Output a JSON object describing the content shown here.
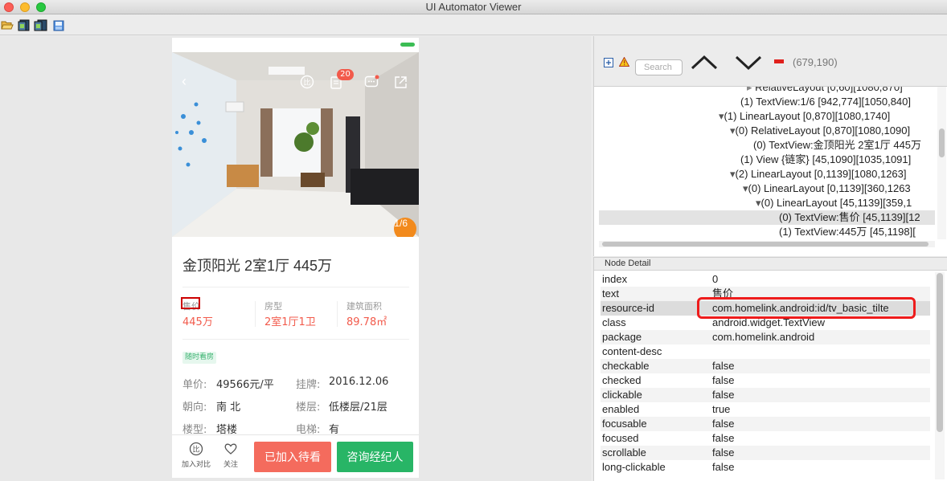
{
  "window": {
    "title": "UI Automator Viewer"
  },
  "toolbar": {
    "icons": [
      "open-folder-icon",
      "device-screenshot-icon",
      "device-screenshot-compressed-icon",
      "save-icon"
    ]
  },
  "device": {
    "photo_counter": "1/6",
    "compare_badge": "20",
    "title": "金顶阳光 2室1厅 445万",
    "stats": [
      {
        "label": "售价",
        "value": "445万"
      },
      {
        "label": "房型",
        "value": "2室1厅1卫"
      },
      {
        "label": "建筑面积",
        "value": "89.78㎡"
      }
    ],
    "tag": "随时看房",
    "details": [
      {
        "label": "单价:",
        "value": "49566元/平"
      },
      {
        "label": "挂牌:",
        "value": "2016.12.06"
      },
      {
        "label": "朝向:",
        "value": "南 北"
      },
      {
        "label": "楼层:",
        "value": "低楼层/21层"
      },
      {
        "label": "楼型:",
        "value": "塔楼"
      },
      {
        "label": "电梯:",
        "value": "有"
      }
    ],
    "bottom": {
      "compare_label": "加入对比",
      "follow_label": "关注",
      "added_label": "已加入待看",
      "consult_label": "咨询经纪人"
    },
    "accent_color": "#f25a4b",
    "green_color": "#28b566"
  },
  "hierarchy": {
    "search_placeholder": "Search",
    "coordinates": "(679,190)",
    "nodes": [
      "RelativeLayout [0,60][1080,870]",
      "(1) TextView:1/6 [942,774][1050,840]",
      "(1) LinearLayout [0,870][1080,1740]",
      "(0) RelativeLayout [0,870][1080,1090]",
      "(0) TextView:金顶阳光 2室1厅 445万",
      "(1) View {链家} [45,1090][1035,1091]",
      "(2) LinearLayout [0,1139][1080,1263]",
      "(0) LinearLayout [0,1139][360,1263",
      "(0) LinearLayout [45,1139][359,1",
      "(0) TextView:售价 [45,1139][12",
      "(1) TextView:445万 [45,1198]["
    ]
  },
  "node_detail": {
    "header": "Node Detail",
    "rows": [
      {
        "key": "index",
        "value": "0"
      },
      {
        "key": "text",
        "value": "售价"
      },
      {
        "key": "resource-id",
        "value": "com.homelink.android:id/tv_basic_tilte"
      },
      {
        "key": "class",
        "value": "android.widget.TextView"
      },
      {
        "key": "package",
        "value": "com.homelink.android"
      },
      {
        "key": "content-desc",
        "value": ""
      },
      {
        "key": "checkable",
        "value": "false"
      },
      {
        "key": "checked",
        "value": "false"
      },
      {
        "key": "clickable",
        "value": "false"
      },
      {
        "key": "enabled",
        "value": "true"
      },
      {
        "key": "focusable",
        "value": "false"
      },
      {
        "key": "focused",
        "value": "false"
      },
      {
        "key": "scrollable",
        "value": "false"
      },
      {
        "key": "long-clickable",
        "value": "false"
      }
    ]
  }
}
